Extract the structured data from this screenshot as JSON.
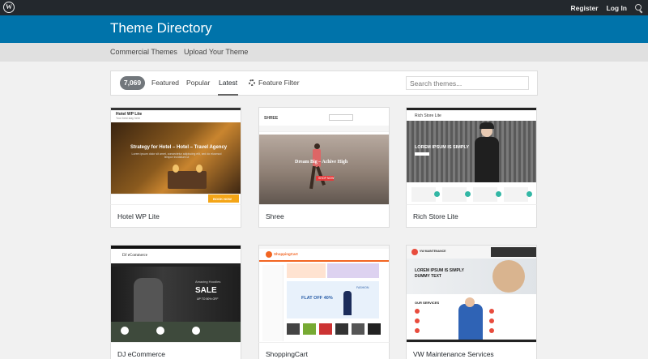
{
  "adminbar": {
    "logo": "W",
    "register": "Register",
    "login": "Log In",
    "search_icon": "search-icon"
  },
  "header": {
    "title": "Theme Directory"
  },
  "subnav": {
    "commercial": "Commercial Themes",
    "upload": "Upload Your Theme"
  },
  "filters": {
    "count": "7,069",
    "featured": "Featured",
    "popular": "Popular",
    "latest": "Latest",
    "feature_filter": "Feature Filter",
    "search_placeholder": "Search themes..."
  },
  "themes": [
    {
      "name": "Hotel WP Lite",
      "shot": {
        "logo": "Hotel WP Lite",
        "tagline": "Your best stay here",
        "headline": "Strategy for Hotel – Hotel – Travel Agency",
        "body": "Lorem ipsum dolor sit amet, consectetur adipiscing elit, sed do eiusmod tempor incididunt ut",
        "cta": "BOOK NOW"
      }
    },
    {
      "name": "Shree",
      "shot": {
        "logo": "SHREE",
        "headline": "Dream Big – Achive High",
        "cta": "SHOP NOW"
      }
    },
    {
      "name": "Rich Store Lite",
      "shot": {
        "logo": "Rich Store Lite",
        "headline": "LOREM IPSUM IS SIMPLY"
      }
    },
    {
      "name": "DJ eCommerce",
      "shot": {
        "logo": "DJ eCommerce",
        "kicker": "Amazing Hoodies",
        "headline": "SALE",
        "sub": "UP TO 50% OFF"
      }
    },
    {
      "name": "ShoppingCart",
      "shot": {
        "logo": "ShoppingCart",
        "promo": "FLAT OFF 40%",
        "tag": "FASHION"
      }
    },
    {
      "name": "VW Maintenance Services",
      "shot": {
        "logo": "VW MAINTENANCE",
        "headline": "LOREM IPSUM IS SIMPLY DUMMY TEXT",
        "section": "OUR SERVICES"
      }
    }
  ]
}
